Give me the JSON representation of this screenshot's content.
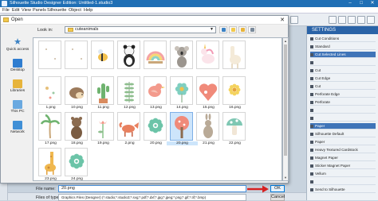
{
  "app": {
    "title": "Silhouette Studio Designer Edition: Untitled-1.studio3",
    "menu": [
      "File",
      "Edit",
      "View",
      "Panels",
      "Silhouette",
      "Object",
      "Help"
    ]
  },
  "right_panel": {
    "header": "SETTINGS",
    "rows": [
      {
        "label": "Cut Conditions",
        "style": "plain"
      },
      {
        "label": "Standard",
        "style": "plain"
      },
      {
        "label": "Cut Selected Lines",
        "style": "blue"
      },
      {
        "label": "",
        "style": "plain"
      },
      {
        "label": "Cut",
        "style": "plain"
      },
      {
        "label": "Cut Edge",
        "style": "plain"
      },
      {
        "label": "Cut",
        "style": "plain"
      },
      {
        "label": "Perforate Edge",
        "style": "plain"
      },
      {
        "label": "Perforate",
        "style": "plain"
      },
      {
        "label": "",
        "style": "plain"
      },
      {
        "label": "",
        "style": "plain"
      },
      {
        "label": "Paper",
        "style": "blue"
      },
      {
        "label": "Silhouette Default",
        "style": "plain"
      },
      {
        "label": "Paper",
        "style": "plain"
      },
      {
        "label": "Heavy Textured Cardstock",
        "style": "plain"
      },
      {
        "label": "Magnet Paper",
        "style": "plain"
      },
      {
        "label": "Sticker Magnet Paper",
        "style": "plain"
      },
      {
        "label": "Vellum",
        "style": "plain"
      },
      {
        "label": "",
        "style": "plain"
      },
      {
        "label": "Send to Silhouette",
        "style": "plain"
      }
    ]
  },
  "dialog": {
    "title": "Open",
    "look_in_label": "Look in:",
    "look_in_value": "cuteanimals",
    "close_glyph": "✕",
    "places": [
      {
        "label": "Quick access",
        "icon": "star-icon",
        "color": "#3b82c4"
      },
      {
        "label": "Desktop",
        "icon": "desktop-icon",
        "color": "#2f7dd0"
      },
      {
        "label": "Libraries",
        "icon": "library-icon",
        "color": "#e7b43b"
      },
      {
        "label": "This PC",
        "icon": "computer-icon",
        "color": "#6aa9e0"
      },
      {
        "label": "Network",
        "icon": "network-icon",
        "color": "#3f8fd6"
      }
    ],
    "files": [
      {
        "label": "",
        "art": "sparse-dots",
        "selected": false
      },
      {
        "label": "",
        "art": "sparse-dots",
        "selected": false
      },
      {
        "label": "",
        "art": "bee",
        "selected": false
      },
      {
        "label": "",
        "art": "panda",
        "selected": false
      },
      {
        "label": "",
        "art": "snail-rainbow",
        "selected": false
      },
      {
        "label": "",
        "art": "koala",
        "selected": false
      },
      {
        "label": "",
        "art": "unicorn",
        "selected": false
      },
      {
        "label": "",
        "art": "llama",
        "selected": false
      },
      {
        "label": "1.png",
        "art": "dots",
        "selected": false
      },
      {
        "label": "10.png",
        "art": "hedgehog",
        "selected": false
      },
      {
        "label": "11.png",
        "art": "cactus",
        "selected": false
      },
      {
        "label": "12.png",
        "art": "sprig",
        "selected": false
      },
      {
        "label": "13.png",
        "art": "bird",
        "selected": false
      },
      {
        "label": "14.png",
        "art": "flower",
        "selected": false
      },
      {
        "label": "15.png",
        "art": "heart",
        "selected": false
      },
      {
        "label": "16.png",
        "art": "flower-yellow",
        "selected": false
      },
      {
        "label": "17.png",
        "art": "palm",
        "selected": false
      },
      {
        "label": "18.png",
        "art": "bear",
        "selected": false
      },
      {
        "label": "19.png",
        "art": "tulip",
        "selected": false
      },
      {
        "label": "2.png",
        "art": "fox",
        "selected": false
      },
      {
        "label": "20.png",
        "art": "green-flower",
        "selected": false
      },
      {
        "label": "20.png",
        "art": "tree",
        "selected": true
      },
      {
        "label": "21.png",
        "art": "bunny",
        "selected": false
      },
      {
        "label": "22.png",
        "art": "mushroom",
        "selected": false
      },
      {
        "label": "23.png",
        "art": "giraffe",
        "selected": false
      },
      {
        "label": "24.png",
        "art": "green-flower",
        "selected": false
      }
    ],
    "file_name_label": "File name:",
    "file_name_value": "20.png",
    "file_type_label": "Files of type:",
    "file_type_value": "Graphics Files (Designer) (*.studio;*.studio3;*.svg;*.pdf;*.dxf;*.jpg;*.jpeg;*.png;*.gif;*.tif;*.bmp)",
    "ok_label": "OK",
    "cancel_label": "Cancel"
  }
}
